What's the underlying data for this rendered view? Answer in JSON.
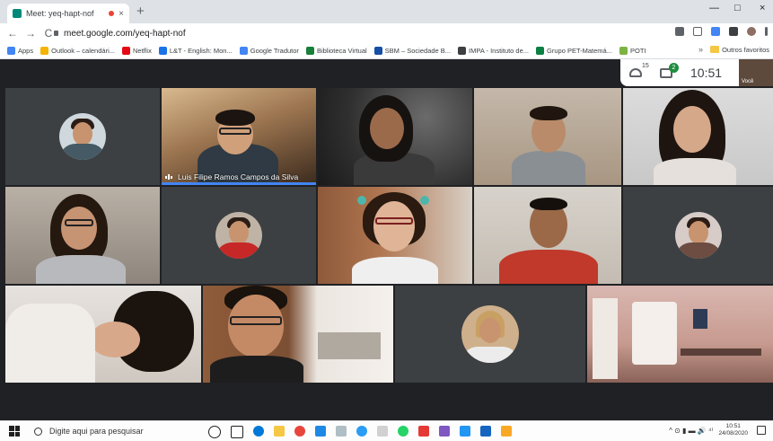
{
  "browser": {
    "tab_title": "Meet: yeq-hapt-nof",
    "tab_close": "×",
    "new_tab": "+",
    "url": "meet.google.com/yeq-hapt-nof",
    "back": "←",
    "forward": "→",
    "reload": "C",
    "minimize": "—",
    "maximize": "□",
    "close": "×"
  },
  "bookmarks": {
    "items": [
      {
        "label": "Apps",
        "color": "#4285f4"
      },
      {
        "label": "Outlook – calendári...",
        "color": "#f4b400"
      },
      {
        "label": "Netflix",
        "color": "#e50914"
      },
      {
        "label": "L&T - English: Mon...",
        "color": "#1a73e8"
      },
      {
        "label": "Google Tradutor",
        "color": "#4285f4"
      },
      {
        "label": "Biblioteca Virtual",
        "color": "#188038"
      },
      {
        "label": "SBM – Sociedade B...",
        "color": "#174ea6"
      },
      {
        "label": "IMPA - Instituto de...",
        "color": "#3c4043"
      },
      {
        "label": "Grupo PET-Matemá...",
        "color": "#0b8043"
      },
      {
        "label": "POTI",
        "color": "#7cb342"
      }
    ],
    "more": "»",
    "other": "Outros favoritos"
  },
  "meet": {
    "people_count": "15",
    "chat_badge": "2",
    "time": "10:51",
    "self_label": "Você",
    "speaker_name": "Luis Filipe Ramos Campos da Silva"
  },
  "taskbar": {
    "search_placeholder": "Digite aqui para pesquisar",
    "tray_icons": "^ ⊙ ▮ ▬ 🔊 ⁴⁾",
    "clock_time": "10:51",
    "clock_date": "24/08/2020"
  }
}
